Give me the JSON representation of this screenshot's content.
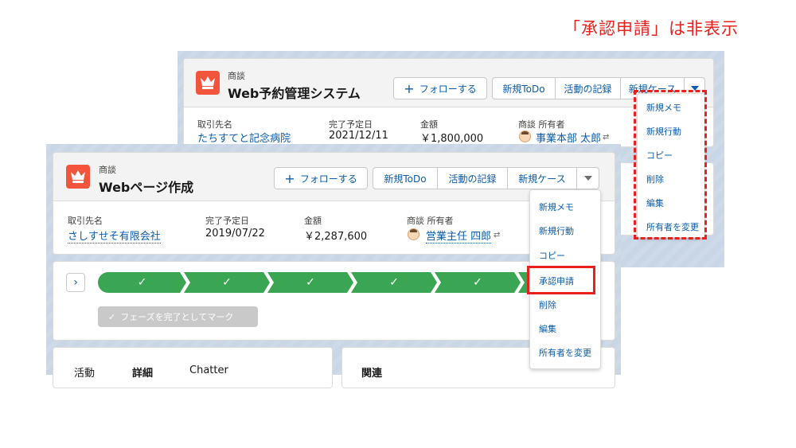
{
  "annotation": "「承認申請」は非表示",
  "colors": {
    "accent_red": "#e8211d",
    "link_blue": "#0b5cab",
    "path_green": "#3aa552",
    "record_icon": "#f2553c"
  },
  "back_window": {
    "object_type": "商談",
    "record_name": "Web予約管理システム",
    "icon": "crown-icon",
    "buttons": {
      "follow": "フォローする",
      "new_todo": "新規ToDo",
      "log_activity": "活動の記録",
      "new_case": "新規ケース"
    },
    "fields": {
      "account_label": "取引先名",
      "account_value": "たちすてと記念病院",
      "close_date_label": "完了予定日",
      "close_date_value": "2021/12/11",
      "amount_label": "金額",
      "amount_value": "￥1,800,000",
      "owner_label": "商談 所有者",
      "owner_value": "事業本部 太郎"
    },
    "menu": [
      "新規メモ",
      "新規行動",
      "コピー",
      "削除",
      "編集",
      "所有者を変更"
    ]
  },
  "front_window": {
    "object_type": "商談",
    "record_name": "Webページ作成",
    "icon": "crown-icon",
    "buttons": {
      "follow": "フォローする",
      "new_todo": "新規ToDo",
      "log_activity": "活動の記録",
      "new_case": "新規ケース"
    },
    "fields": {
      "account_label": "取引先名",
      "account_value": "さしすせそ有限会社",
      "close_date_label": "完了予定日",
      "close_date_value": "2019/07/22",
      "amount_label": "金額",
      "amount_value": "￥2,287,600",
      "owner_label": "商談 所有者",
      "owner_value": "営業主任 四郎"
    },
    "path": {
      "toggle": "›",
      "stage_check": "✓",
      "mark_complete": "フェーズを完了としてマーク"
    },
    "tabs": {
      "activity": "活動",
      "details": "詳細",
      "chatter": "Chatter",
      "related": "関連"
    },
    "menu": [
      "新規メモ",
      "新規行動",
      "コピー",
      "承認申請",
      "削除",
      "編集",
      "所有者を変更"
    ]
  }
}
